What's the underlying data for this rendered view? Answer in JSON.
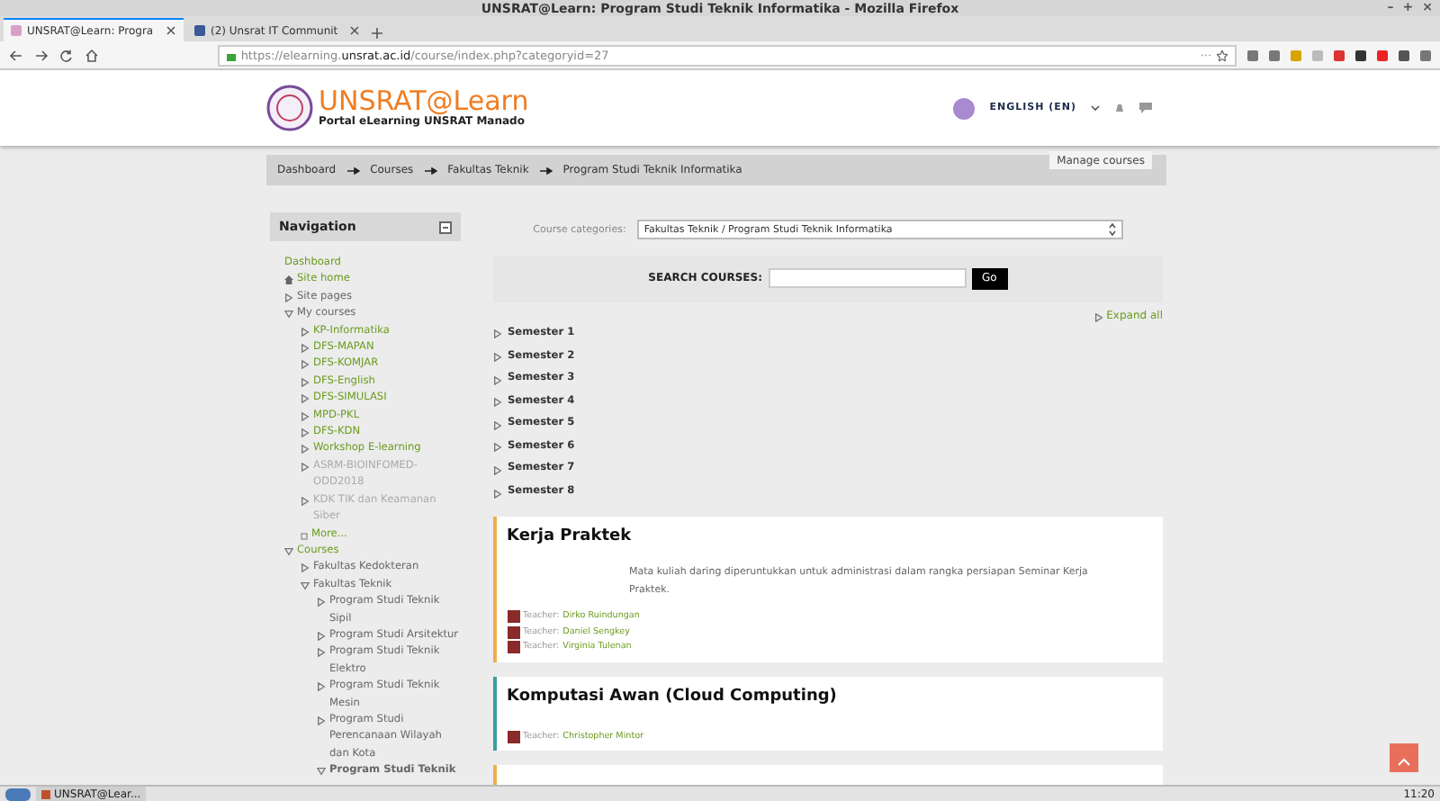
{
  "window": {
    "title": "UNSRAT@Learn: Program Studi Teknik Informatika - Mozilla Firefox",
    "controls": [
      "–",
      "+",
      "×"
    ]
  },
  "tabs": [
    {
      "label": "UNSRAT@Learn: Progra",
      "selected": true
    },
    {
      "label": "(2) Unsrat IT Communit",
      "selected": false
    }
  ],
  "address_bar": {
    "url_prefix": "https://elearning.",
    "url_domain": "unsrat.ac.id",
    "url_path": "/course/index.php?categoryid=27",
    "more": "···"
  },
  "site_header": {
    "logo_title": "UNSRAT@Learn",
    "logo_subtitle": "Portal eLearning UNSRAT Manado",
    "language": "ENGLISH (EN)"
  },
  "breadcrumb": [
    "Dashboard",
    "Courses",
    "Fakultas Teknik",
    "Program Studi Teknik Informatika"
  ],
  "manage_button": "Manage courses",
  "navigation": {
    "title": "Navigation",
    "items": [
      {
        "label": "Dashboard",
        "kind": "link"
      },
      {
        "label": "Site home",
        "kind": "home"
      },
      {
        "label": "Site pages",
        "kind": "branch",
        "expanded": false
      },
      {
        "label": "My courses",
        "kind": "branch",
        "expanded": true,
        "children": [
          {
            "label": "KP-Informatika",
            "kind": "course",
            "expanded": false
          },
          {
            "label": "DFS-MAPAN",
            "kind": "course",
            "expanded": false
          },
          {
            "label": "DFS-KOMJAR",
            "kind": "course",
            "expanded": false
          },
          {
            "label": "DFS-English",
            "kind": "course",
            "expanded": false
          },
          {
            "label": "DFS-SIMULASI",
            "kind": "course",
            "expanded": false
          },
          {
            "label": "MPD-PKL",
            "kind": "course",
            "expanded": false
          },
          {
            "label": "DFS-KDN",
            "kind": "course",
            "expanded": false
          },
          {
            "label": "Workshop E-learning",
            "kind": "course",
            "expanded": false
          },
          {
            "label": "ASRM-BIOINFOMED-ODD2018",
            "kind": "dimmed",
            "expanded": false
          },
          {
            "label": "KDK TIK dan Keamanan Siber",
            "kind": "dimmed",
            "expanded": false
          },
          {
            "label": "More...",
            "kind": "more"
          }
        ]
      },
      {
        "label": "Courses",
        "kind": "link-branch",
        "expanded": true,
        "children": [
          {
            "label": "Fakultas Kedokteran",
            "kind": "branch",
            "expanded": false
          },
          {
            "label": "Fakultas Teknik",
            "kind": "branch",
            "expanded": true,
            "children": [
              {
                "label": "Program Studi Teknik Sipil",
                "kind": "branch",
                "expanded": false
              },
              {
                "label": "Program Studi Arsitektur",
                "kind": "branch",
                "expanded": false
              },
              {
                "label": "Program Studi Teknik Elektro",
                "kind": "branch",
                "expanded": false
              },
              {
                "label": "Program Studi Teknik Mesin",
                "kind": "branch",
                "expanded": false
              },
              {
                "label": "Program Studi Perencanaan Wilayah dan Kota",
                "kind": "branch",
                "expanded": false
              },
              {
                "label": "Program Studi Teknik",
                "kind": "current",
                "expanded": true
              }
            ]
          }
        ]
      }
    ]
  },
  "category_select": {
    "label": "Course categories:",
    "value": "Fakultas Teknik / Program Studi Teknik Informatika"
  },
  "search": {
    "label": "SEARCH COURSES:",
    "button": "Go"
  },
  "expand_all": "Expand all",
  "semesters": [
    {
      "label": "Semester 1",
      "expanded": false
    },
    {
      "label": "Semester 2",
      "expanded": false
    },
    {
      "label": "Semester 3",
      "expanded": false
    },
    {
      "label": "Semester 4",
      "expanded": false
    },
    {
      "label": "Semester 5",
      "expanded": false
    },
    {
      "label": "Semester 6",
      "expanded": false
    },
    {
      "label": "Semester 7",
      "expanded": false
    },
    {
      "label": "Semester 8",
      "expanded": false
    }
  ],
  "courses": [
    {
      "title": "Kerja Praktek",
      "color": "#f0ad4e",
      "summary": "Mata kuliah daring diperuntukkan untuk administrasi dalam rangka persiapan Seminar Kerja Praktek.",
      "teachers": [
        {
          "role": "Teacher:",
          "name": "Dirko Ruindungan"
        },
        {
          "role": "Teacher:",
          "name": "Daniel Sengkey"
        },
        {
          "role": "Teacher:",
          "name": "Virginia Tulenan"
        }
      ]
    },
    {
      "title": "Komputasi Awan (Cloud Computing)",
      "color": "#3a9e9e",
      "teachers": [
        {
          "role": "Teacher:",
          "name": "Christopher Mintor"
        }
      ]
    },
    {
      "color": "#f0ad4e"
    }
  ],
  "taskbar": {
    "window_button": "UNSRAT@Lear...",
    "clock": "11:20"
  }
}
